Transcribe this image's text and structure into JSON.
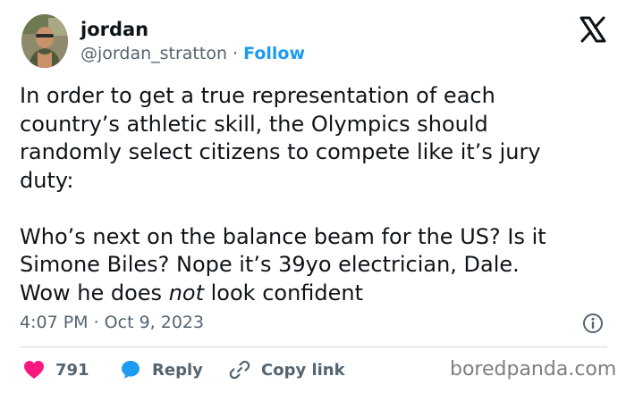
{
  "author": {
    "name": "jordan",
    "handle": "@jordan_stratton",
    "separator": " · ",
    "follow_label": "Follow"
  },
  "tweet": {
    "line1": "In order to get a true representation of each",
    "line2": "country’s athletic skill, the Olympics should",
    "line3": "randomly select citizens to compete like it’s jury",
    "line4": "duty:",
    "line5": "Who’s next on the balance beam for the US? Is it",
    "line6": "Simone Biles? Nope it’s 39yo electrician, Dale.",
    "line7_pre": "Wow he does ",
    "line7_em": "not",
    "line7_post": " look confident",
    "timestamp": "4:07 PM · Oct 9, 2023"
  },
  "actions": {
    "like_count": "791",
    "reply_label": "Reply",
    "copy_label": "Copy link"
  },
  "watermark": "boredpanda.com",
  "icons": {
    "brand": "x-logo-icon",
    "like": "heart-icon",
    "reply": "speech-bubble-icon",
    "copy": "link-icon",
    "info": "info-icon"
  },
  "colors": {
    "text": "#0f1419",
    "muted": "#536471",
    "accent": "#1d9bf0",
    "heart": "#f91880",
    "divider": "#cfd9de"
  }
}
